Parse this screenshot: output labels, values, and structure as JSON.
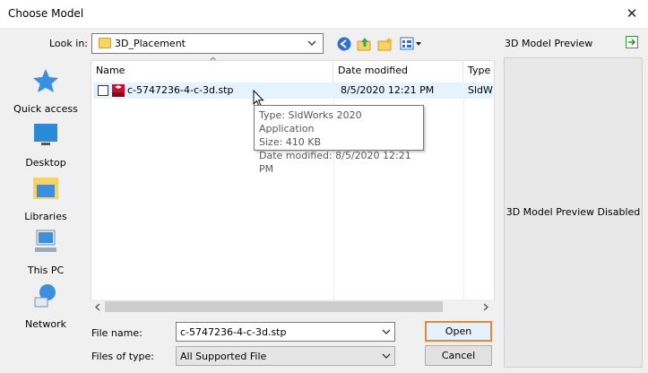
{
  "window": {
    "title": "Choose Model",
    "close_glyph": "✕"
  },
  "toolbar": {
    "look_in_label": "Look in:",
    "look_in_value": "3D_Placement",
    "icons": [
      "back-icon",
      "up-folder-icon",
      "new-folder-icon",
      "view-menu-icon"
    ]
  },
  "places": [
    {
      "label": "Quick access",
      "icon": "star-icon"
    },
    {
      "label": "Desktop",
      "icon": "desktop-icon"
    },
    {
      "label": "Libraries",
      "icon": "libraries-icon"
    },
    {
      "label": "This PC",
      "icon": "computer-icon"
    },
    {
      "label": "Network",
      "icon": "network-icon"
    }
  ],
  "file_list": {
    "columns": [
      "Name",
      "Date modified",
      "Type"
    ],
    "rows": [
      {
        "name": "c-5747236-4-c-3d.stp",
        "date": "8/5/2020 12:21 PM",
        "type": "SldW"
      }
    ],
    "sort_glyph": "^"
  },
  "tooltip": {
    "type_line": "Type: SldWorks 2020 Application",
    "size_line": "Size: 410 KB",
    "date_line": "Date modified: 8/5/2020 12:21 PM"
  },
  "form": {
    "file_name_label": "File name:",
    "file_name_value": "c-5747236-4-c-3d.stp",
    "file_type_label": "Files of type:",
    "file_type_value": "All Supported File"
  },
  "buttons": {
    "open": "Open",
    "cancel": "Cancel"
  },
  "preview": {
    "title": "3D Model Preview",
    "disabled_text": "3D Model Preview Disabled"
  },
  "colors": {
    "accent_border": "#e08a3c",
    "selection": "#e5f3ff"
  }
}
